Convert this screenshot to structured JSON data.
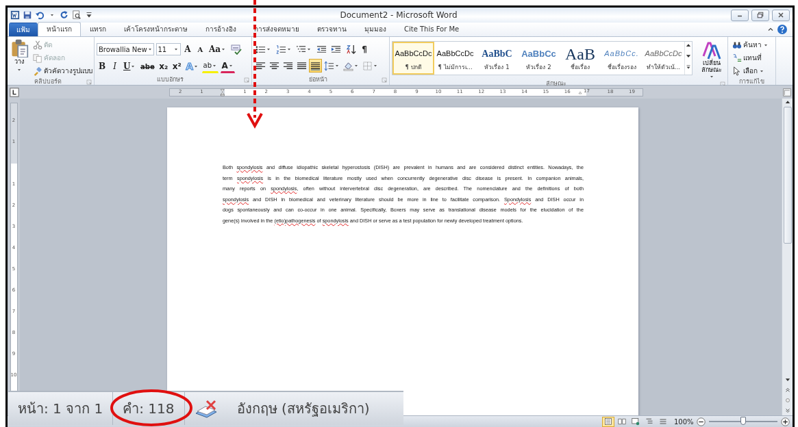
{
  "title_bar": {
    "title": "Document2 - Microsoft Word"
  },
  "tabs": [
    {
      "label": "แฟ้ม",
      "kind": "file",
      "selected": false
    },
    {
      "label": "หน้าแรก",
      "kind": "tab",
      "selected": true
    },
    {
      "label": "แทรก",
      "kind": "tab",
      "selected": false
    },
    {
      "label": "เค้าโครงหน้ากระดาษ",
      "kind": "tab",
      "selected": false
    },
    {
      "label": "การอ้างอิง",
      "kind": "tab",
      "selected": false
    },
    {
      "label": "การส่งจดหมาย",
      "kind": "tab",
      "selected": false
    },
    {
      "label": "ตรวจทาน",
      "kind": "tab",
      "selected": false
    },
    {
      "label": "มุมมอง",
      "kind": "tab",
      "selected": false
    },
    {
      "label": "Cite This For Me",
      "kind": "tab",
      "selected": false
    }
  ],
  "clipboard": {
    "title": "คลิปบอร์ด",
    "paste": "วาง",
    "items": [
      {
        "label": "ตัด",
        "kind": "cut",
        "disabled": true
      },
      {
        "label": "คัดลอก",
        "kind": "copy",
        "disabled": true
      },
      {
        "label": "ตัวคัดวางรูปแบบ",
        "kind": "painter",
        "disabled": false
      }
    ]
  },
  "font": {
    "title": "แบบอักษร",
    "font_name": "Browallia New",
    "font_size": "11",
    "row1": [
      {
        "label": "A",
        "kind": "grow"
      },
      {
        "label": "A",
        "kind": "shrink"
      },
      {
        "label": "Aa",
        "kind": "case"
      }
    ],
    "row2": [
      {
        "label": "B",
        "kind": "bold"
      },
      {
        "label": "I",
        "kind": "italic"
      },
      {
        "label": "U",
        "kind": "underline"
      },
      {
        "label": "abe",
        "kind": "strike"
      },
      {
        "label": "x₂",
        "kind": "sub"
      },
      {
        "label": "x²",
        "kind": "sup"
      },
      {
        "label": "A",
        "kind": "effects"
      },
      {
        "label": "ab",
        "kind": "highlight"
      },
      {
        "label": "A",
        "kind": "color"
      }
    ]
  },
  "paragraph": {
    "title": "ย่อหน้า",
    "pilcrow": "¶",
    "alignments": [
      {
        "kind": "left",
        "selected": false
      },
      {
        "kind": "center",
        "selected": false
      },
      {
        "kind": "right",
        "selected": false
      },
      {
        "kind": "justify",
        "selected": false
      },
      {
        "kind": "distributed",
        "selected": true
      }
    ]
  },
  "styles": {
    "title": "ลักษณะ",
    "change_styles": "เปลี่ยน ลักษณะ",
    "items": [
      {
        "preview": "AaBbCcDc",
        "name": "¶ ปกติ",
        "kind": "normal",
        "selected": true
      },
      {
        "preview": "AaBbCcDc",
        "name": "¶ ไม่มีการเ...",
        "kind": "normal",
        "selected": false
      },
      {
        "preview": "AaBbC",
        "name": "หัวเรื่อง 1",
        "kind": "heading1",
        "selected": false
      },
      {
        "preview": "AaBbCc",
        "name": "หัวเรื่อง 2",
        "kind": "heading2",
        "selected": false
      },
      {
        "preview": "AaB",
        "name": "ชื่อเรื่อง",
        "kind": "title",
        "selected": false
      },
      {
        "preview": "AaBbCc.",
        "name": "ชื่อเรื่องรอง",
        "kind": "subtitle",
        "selected": false
      },
      {
        "preview": "AaBbCcDc",
        "name": "ทำให้ตัวเน้...",
        "kind": "emphasis",
        "selected": false
      }
    ]
  },
  "editing": {
    "title": "การแก้ไข",
    "items": [
      {
        "label": "ค้นหา",
        "kind": "find"
      },
      {
        "label": "แทนที่",
        "kind": "replace"
      },
      {
        "label": "เลือก",
        "kind": "select"
      }
    ]
  },
  "ruler": {
    "labels_before": [
      "2",
      "1"
    ],
    "labels": [
      "1",
      "2",
      "3",
      "4",
      "5",
      "6",
      "7",
      "8",
      "9",
      "10",
      "11",
      "12",
      "13",
      "14",
      "15",
      "16",
      "17",
      "18",
      "19"
    ],
    "vertical_before": [
      "2",
      "1"
    ],
    "vertical_labels": [
      "1",
      "2",
      "3",
      "4",
      "5",
      "6",
      "7",
      "8",
      "9",
      "10"
    ]
  },
  "document": {
    "lines": [
      [
        {
          "text": "Both ",
          "misspelled": false
        },
        {
          "text": "spondylosis",
          "misspelled": true
        },
        {
          "text": " and diffuse idiopathic skeletal hyperostosis (DISH) are prevalent in humans and are considered distinct entities. Nowadays, the",
          "misspelled": false
        }
      ],
      [
        {
          "text": "term ",
          "misspelled": false
        },
        {
          "text": "spondylosis",
          "misspelled": true
        },
        {
          "text": " is in the biomedical literature mostly used when concurrently degenerative disc disease is present. In companion animals,",
          "misspelled": false
        }
      ],
      [
        {
          "text": "many reports on ",
          "misspelled": false
        },
        {
          "text": "spondylosis",
          "misspelled": true
        },
        {
          "text": ", often without intervertebral disc degeneration, are described. The nomenclature and the definitions of both",
          "misspelled": false
        }
      ],
      [
        {
          "text": "spondylosis",
          "misspelled": true
        },
        {
          "text": " and DISH in biomedical and veterinary literature should be more in line to facilitate comparison. ",
          "misspelled": false
        },
        {
          "text": "Spondylosis",
          "misspelled": true
        },
        {
          "text": " and DISH occur in",
          "misspelled": false
        }
      ],
      [
        {
          "text": "dogs spontaneously and can co-occur in one animal. Specifically, Boxers may serve as translational disease models for the elucidation of the",
          "misspelled": false
        }
      ],
      [
        {
          "text": "gene(s) involved in the ",
          "misspelled": false
        },
        {
          "text": "(etio)pathogenesis",
          "misspelled": true
        },
        {
          "text": "  of ",
          "misspelled": false
        },
        {
          "text": "spondylosis",
          "misspelled": true
        },
        {
          "text": " and DISH or serve as a test population for newly developed treatment options.",
          "misspelled": false
        }
      ]
    ]
  },
  "status_bar": {
    "views": [
      {
        "kind": "print",
        "selected": true
      },
      {
        "kind": "reading",
        "selected": false
      },
      {
        "kind": "web",
        "selected": false
      },
      {
        "kind": "outline",
        "selected": false
      },
      {
        "kind": "draft",
        "selected": false
      }
    ],
    "zoom": "100%",
    "zoom_slider": {
      "level": 0.5
    }
  },
  "callout": {
    "page_info": "หน้า: 1 จาก 1",
    "word_count": "คำ: 118",
    "language": "อังกฤษ (สหรัฐอเมริกา)"
  }
}
